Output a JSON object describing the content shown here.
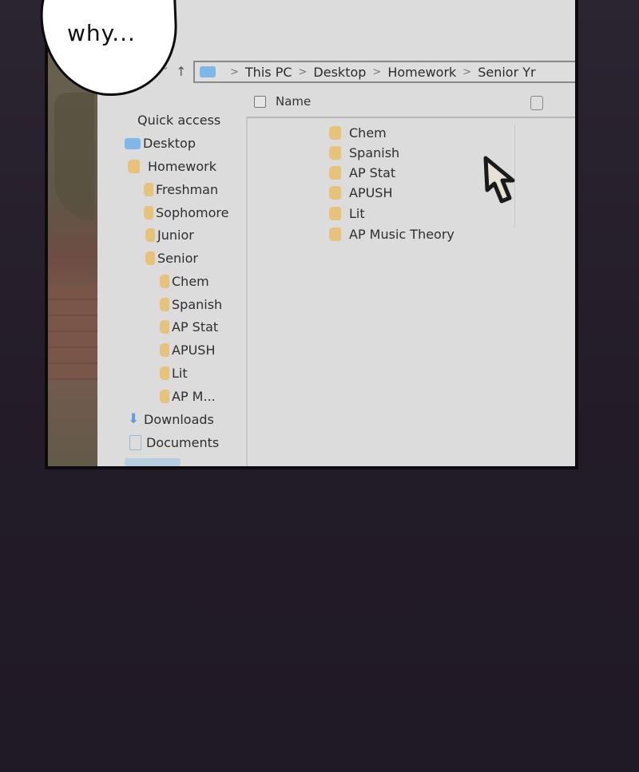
{
  "speech_bubble": {
    "text": "why..."
  },
  "explorer": {
    "breadcrumb": [
      "This PC",
      "Desktop",
      "Homework",
      "Senior Yr"
    ],
    "column_header": "Name",
    "sidebar": [
      {
        "label": "Quick access",
        "icon": "none",
        "indent": 0
      },
      {
        "label": "Desktop",
        "icon": "blue-folder-icon",
        "indent": 0
      },
      {
        "label": "Homework",
        "icon": "folder-icon",
        "indent": 0
      },
      {
        "label": "Freshman",
        "icon": "folder-icon",
        "indent": 1
      },
      {
        "label": "Sophomore",
        "icon": "folder-icon",
        "indent": 1
      },
      {
        "label": "Junior",
        "icon": "folder-icon",
        "indent": 1
      },
      {
        "label": "Senior",
        "icon": "folder-icon",
        "indent": 1
      },
      {
        "label": "Chem",
        "icon": "folder-icon",
        "indent": 2
      },
      {
        "label": "Spanish",
        "icon": "folder-icon",
        "indent": 2
      },
      {
        "label": "AP Stat",
        "icon": "folder-icon",
        "indent": 2
      },
      {
        "label": "APUSH",
        "icon": "folder-icon",
        "indent": 2
      },
      {
        "label": "Lit",
        "icon": "folder-icon",
        "indent": 2
      },
      {
        "label": "AP M...",
        "icon": "folder-icon",
        "indent": 2
      },
      {
        "label": "Downloads",
        "icon": "download-icon",
        "indent": 0
      },
      {
        "label": "Documents",
        "icon": "document-icon",
        "indent": 0
      }
    ],
    "files": [
      "Chem",
      "Spanish",
      "AP Stat",
      "APUSH",
      "Lit",
      "AP Music Theory"
    ]
  },
  "colors": {
    "folder": "#e7c27a",
    "accent_blue": "#7fb8e8",
    "window_bg": "#dcdcdc",
    "page_bg": "#2b2431"
  }
}
